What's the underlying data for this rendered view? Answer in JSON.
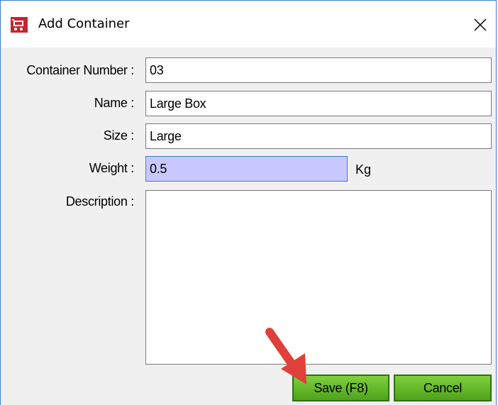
{
  "window": {
    "title": "Add Container",
    "icon": "shopping-cart-icon",
    "close_icon": "close-icon"
  },
  "form": {
    "container_number": {
      "label": "Container Number :",
      "value": "03"
    },
    "name": {
      "label": "Name :",
      "value": "Large Box"
    },
    "size": {
      "label": "Size :",
      "value": "Large"
    },
    "weight": {
      "label": "Weight :",
      "value": "0.5",
      "unit": "Kg"
    },
    "description": {
      "label": "Description :",
      "value": ""
    }
  },
  "buttons": {
    "save": "Save (F8)",
    "cancel": "Cancel"
  },
  "colors": {
    "button_green": "#5fb428",
    "focused_field": "#c8c8ff",
    "annotation_arrow": "#e0403a"
  }
}
